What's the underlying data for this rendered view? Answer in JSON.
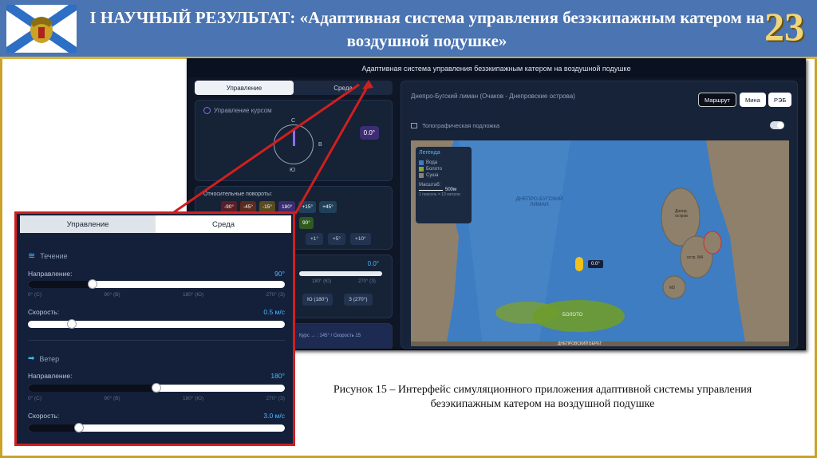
{
  "slide": {
    "title": "I НАУЧНЫЙ РЕЗУЛЬТАТ: «Адаптивная система управления безэкипажным катером на воздушной подушке»",
    "page_number": "23",
    "caption": "Рисунок 15 – Интерфейс симуляционного приложения адаптивной системы управления безэкипажным катером на воздушной подушке"
  },
  "colors": {
    "header": "#4a74b2",
    "frame": "#c9a227",
    "accent": "#48b8ff",
    "highlight": "#d01f1f"
  },
  "app": {
    "window_title": "Адаптивная система управления безэкипажным катером на воздушной подушке",
    "tabs": [
      "Управление",
      "Среда"
    ],
    "active_tab": "Управление",
    "course_control": {
      "label": "Управление курсом",
      "heading_value": "0.0°",
      "compass": {
        "n": "С",
        "e": "В",
        "s": "Ю"
      }
    },
    "relative_turns": {
      "label": "Относительные повороты:",
      "buttons_row1": [
        "-90°",
        "-45°",
        "-15°",
        "180°",
        "+15°",
        "+45°"
      ],
      "buttons_row2": [
        "90°"
      ],
      "buttons_row3": [
        "+1°",
        "+5°",
        "+10°"
      ]
    },
    "absolute": {
      "value": "0.0°",
      "ticks": [
        "180° (Ю)",
        "270° (З)"
      ],
      "buttons": [
        "Ю (180°)",
        "З (270°)"
      ]
    },
    "status_line": "Курс → : 145° / Скорость 15",
    "right_panel": {
      "area_title": "Днепро-Бугский лиман (Очаков - Днепровские острова)",
      "mode_buttons": [
        "Маршрут",
        "Мина",
        "РЭБ"
      ],
      "active_mode": "Маршрут",
      "topo_label": "Топографическая подложка",
      "legend": {
        "title": "Легенда",
        "items": [
          {
            "label": "Вода",
            "color": "#3e7dc1"
          },
          {
            "label": "Болото",
            "color": "#8aa33a"
          },
          {
            "label": "Суша",
            "color": "#8f806c"
          }
        ],
        "scale_label": "Масштаб:",
        "scale_value": "500м",
        "scale_note": "1 пиксель = 10 метров"
      },
      "map_labels": {
        "liman": "ДНЕПРО-БУГСКИЙ ЛИМАН",
        "swamp": "БОЛОТО",
        "boat_heading": "0.0°",
        "island1": "Днепр. остров",
        "island2": "остр. М4",
        "island3": "М3",
        "bottom": "ДНЕПРОВСКИЙ БЕРЕГ"
      }
    }
  },
  "inset": {
    "tabs": [
      "Управление",
      "Среда"
    ],
    "active_tab": "Среда",
    "current": {
      "section_label": "Течение",
      "direction_label": "Направление:",
      "direction_value": "90°",
      "direction_fraction": 0.25,
      "speed_label": "Скорость:",
      "speed_value": "0.5 м/с",
      "speed_fraction": 0.17
    },
    "wind": {
      "section_label": "Ветер",
      "direction_label": "Направление:",
      "direction_value": "180°",
      "direction_fraction": 0.5,
      "speed_label": "Скорость:",
      "speed_value": "3.0 м/с",
      "speed_fraction": 0.2
    },
    "ticks": [
      "0° (С)",
      "90° (В)",
      "180° (Ю)",
      "270° (З)"
    ]
  }
}
